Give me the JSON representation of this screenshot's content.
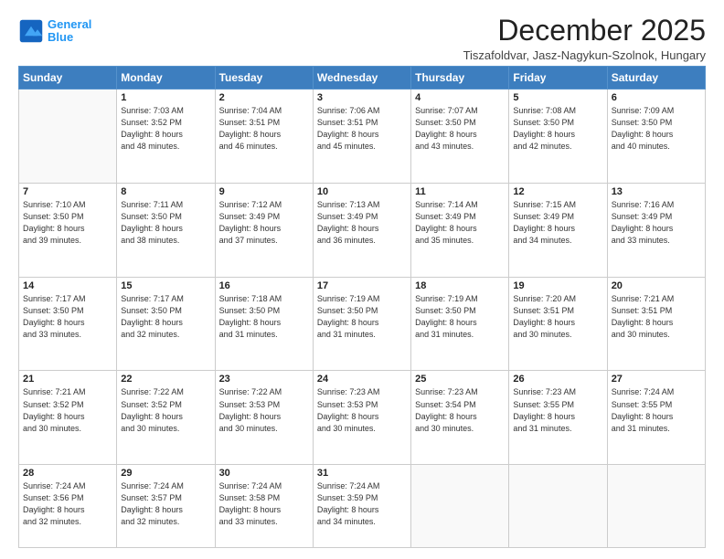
{
  "logo": {
    "line1": "General",
    "line2": "Blue"
  },
  "title": "December 2025",
  "subtitle": "Tiszafoldvar, Jasz-Nagykun-Szolnok, Hungary",
  "weekdays": [
    "Sunday",
    "Monday",
    "Tuesday",
    "Wednesday",
    "Thursday",
    "Friday",
    "Saturday"
  ],
  "weeks": [
    [
      {
        "day": "",
        "info": ""
      },
      {
        "day": "1",
        "info": "Sunrise: 7:03 AM\nSunset: 3:52 PM\nDaylight: 8 hours\nand 48 minutes."
      },
      {
        "day": "2",
        "info": "Sunrise: 7:04 AM\nSunset: 3:51 PM\nDaylight: 8 hours\nand 46 minutes."
      },
      {
        "day": "3",
        "info": "Sunrise: 7:06 AM\nSunset: 3:51 PM\nDaylight: 8 hours\nand 45 minutes."
      },
      {
        "day": "4",
        "info": "Sunrise: 7:07 AM\nSunset: 3:50 PM\nDaylight: 8 hours\nand 43 minutes."
      },
      {
        "day": "5",
        "info": "Sunrise: 7:08 AM\nSunset: 3:50 PM\nDaylight: 8 hours\nand 42 minutes."
      },
      {
        "day": "6",
        "info": "Sunrise: 7:09 AM\nSunset: 3:50 PM\nDaylight: 8 hours\nand 40 minutes."
      }
    ],
    [
      {
        "day": "7",
        "info": "Sunrise: 7:10 AM\nSunset: 3:50 PM\nDaylight: 8 hours\nand 39 minutes."
      },
      {
        "day": "8",
        "info": "Sunrise: 7:11 AM\nSunset: 3:50 PM\nDaylight: 8 hours\nand 38 minutes."
      },
      {
        "day": "9",
        "info": "Sunrise: 7:12 AM\nSunset: 3:49 PM\nDaylight: 8 hours\nand 37 minutes."
      },
      {
        "day": "10",
        "info": "Sunrise: 7:13 AM\nSunset: 3:49 PM\nDaylight: 8 hours\nand 36 minutes."
      },
      {
        "day": "11",
        "info": "Sunrise: 7:14 AM\nSunset: 3:49 PM\nDaylight: 8 hours\nand 35 minutes."
      },
      {
        "day": "12",
        "info": "Sunrise: 7:15 AM\nSunset: 3:49 PM\nDaylight: 8 hours\nand 34 minutes."
      },
      {
        "day": "13",
        "info": "Sunrise: 7:16 AM\nSunset: 3:49 PM\nDaylight: 8 hours\nand 33 minutes."
      }
    ],
    [
      {
        "day": "14",
        "info": "Sunrise: 7:17 AM\nSunset: 3:50 PM\nDaylight: 8 hours\nand 33 minutes."
      },
      {
        "day": "15",
        "info": "Sunrise: 7:17 AM\nSunset: 3:50 PM\nDaylight: 8 hours\nand 32 minutes."
      },
      {
        "day": "16",
        "info": "Sunrise: 7:18 AM\nSunset: 3:50 PM\nDaylight: 8 hours\nand 31 minutes."
      },
      {
        "day": "17",
        "info": "Sunrise: 7:19 AM\nSunset: 3:50 PM\nDaylight: 8 hours\nand 31 minutes."
      },
      {
        "day": "18",
        "info": "Sunrise: 7:19 AM\nSunset: 3:50 PM\nDaylight: 8 hours\nand 31 minutes."
      },
      {
        "day": "19",
        "info": "Sunrise: 7:20 AM\nSunset: 3:51 PM\nDaylight: 8 hours\nand 30 minutes."
      },
      {
        "day": "20",
        "info": "Sunrise: 7:21 AM\nSunset: 3:51 PM\nDaylight: 8 hours\nand 30 minutes."
      }
    ],
    [
      {
        "day": "21",
        "info": "Sunrise: 7:21 AM\nSunset: 3:52 PM\nDaylight: 8 hours\nand 30 minutes."
      },
      {
        "day": "22",
        "info": "Sunrise: 7:22 AM\nSunset: 3:52 PM\nDaylight: 8 hours\nand 30 minutes."
      },
      {
        "day": "23",
        "info": "Sunrise: 7:22 AM\nSunset: 3:53 PM\nDaylight: 8 hours\nand 30 minutes."
      },
      {
        "day": "24",
        "info": "Sunrise: 7:23 AM\nSunset: 3:53 PM\nDaylight: 8 hours\nand 30 minutes."
      },
      {
        "day": "25",
        "info": "Sunrise: 7:23 AM\nSunset: 3:54 PM\nDaylight: 8 hours\nand 30 minutes."
      },
      {
        "day": "26",
        "info": "Sunrise: 7:23 AM\nSunset: 3:55 PM\nDaylight: 8 hours\nand 31 minutes."
      },
      {
        "day": "27",
        "info": "Sunrise: 7:24 AM\nSunset: 3:55 PM\nDaylight: 8 hours\nand 31 minutes."
      }
    ],
    [
      {
        "day": "28",
        "info": "Sunrise: 7:24 AM\nSunset: 3:56 PM\nDaylight: 8 hours\nand 32 minutes."
      },
      {
        "day": "29",
        "info": "Sunrise: 7:24 AM\nSunset: 3:57 PM\nDaylight: 8 hours\nand 32 minutes."
      },
      {
        "day": "30",
        "info": "Sunrise: 7:24 AM\nSunset: 3:58 PM\nDaylight: 8 hours\nand 33 minutes."
      },
      {
        "day": "31",
        "info": "Sunrise: 7:24 AM\nSunset: 3:59 PM\nDaylight: 8 hours\nand 34 minutes."
      },
      {
        "day": "",
        "info": ""
      },
      {
        "day": "",
        "info": ""
      },
      {
        "day": "",
        "info": ""
      }
    ]
  ]
}
